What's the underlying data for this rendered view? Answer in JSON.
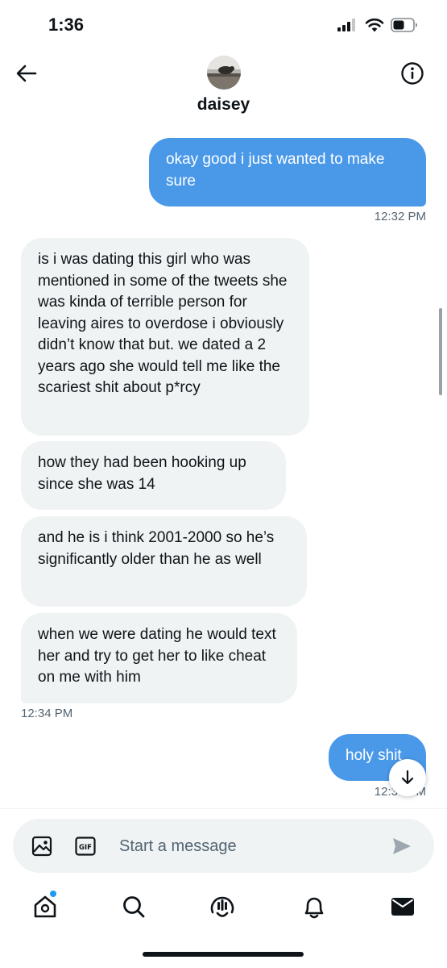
{
  "status_bar": {
    "time": "1:36"
  },
  "header": {
    "contact_name": "daisey",
    "icons": {
      "back": "back-arrow-icon",
      "info": "info-icon"
    }
  },
  "messages": [
    {
      "direction": "sent",
      "text": "okay good i just wanted to make sure"
    },
    {
      "type": "timestamp",
      "text": "12:32 PM"
    },
    {
      "direction": "received",
      "text": "is i was dating this girl who was mentioned in some of the tweets she was kinda of terrible person for leaving aires to overdose i obviously didn’t know that but. we dated a 2 years ago she would tell me like the scariest shit about p*rcy"
    },
    {
      "direction": "received",
      "text": "how they had been hooking up since she was 14"
    },
    {
      "direction": "received",
      "text": "and he is i think 2001-2000 so he’s significantly older than he as well"
    },
    {
      "direction": "received",
      "text": "when we were dating he would text her and try to get her to like cheat on me with him"
    },
    {
      "type": "timestamp",
      "text": "12:34 PM"
    },
    {
      "direction": "sent",
      "text": "holy shit"
    },
    {
      "type": "timestamp",
      "text": "12:34 PM"
    }
  ],
  "composer": {
    "placeholder": "Start a message"
  },
  "tabbar": {
    "items": [
      "home-icon",
      "search-icon",
      "spaces-icon",
      "notifications-icon",
      "messages-icon"
    ]
  },
  "colors": {
    "sent_bubble": "#4a99e9",
    "received_bubble": "#eff3f4",
    "accent": "#1d9bf0"
  }
}
